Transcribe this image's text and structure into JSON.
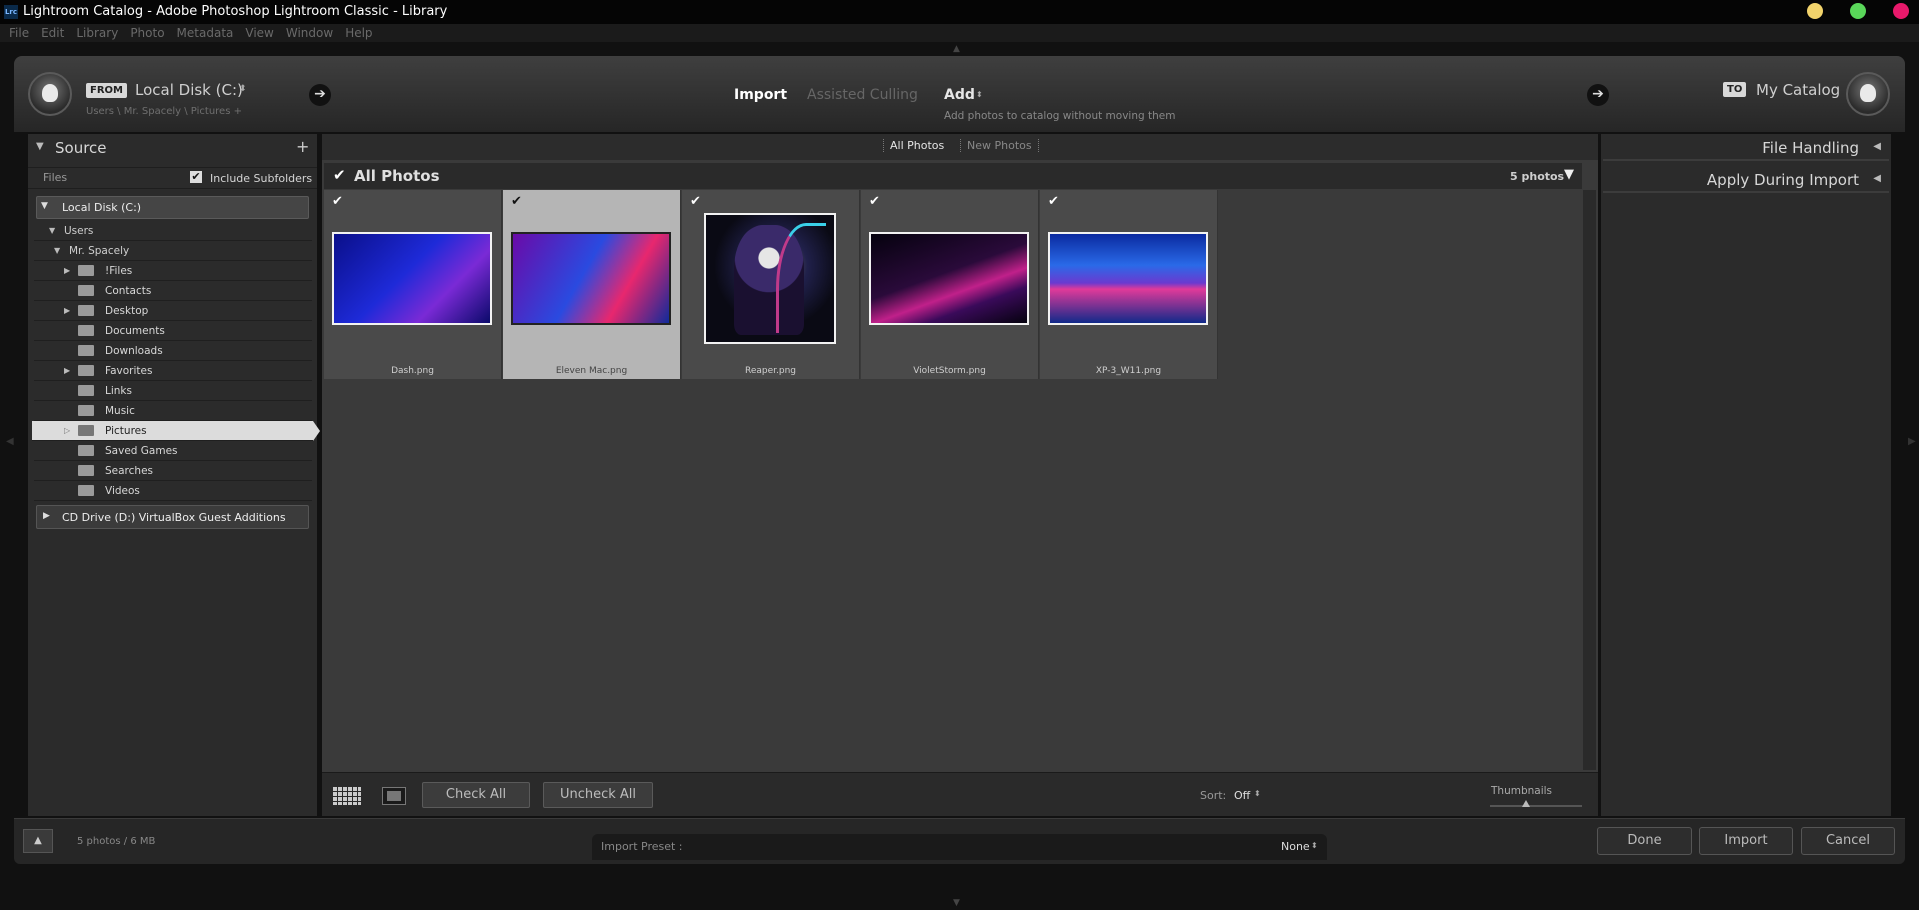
{
  "window": {
    "title": "Lightroom Catalog - Adobe Photoshop Lightroom Classic - Library",
    "app_badge": "Lrc"
  },
  "menu": [
    "File",
    "Edit",
    "Library",
    "Photo",
    "Metadata",
    "View",
    "Window",
    "Help"
  ],
  "header": {
    "from_tag": "FROM",
    "source_name": "Local Disk (C:)",
    "source_path": "Users \\ Mr. Spacely \\ Pictures +",
    "mode_import": "Import",
    "mode_culling": "Assisted Culling",
    "action": "Add",
    "action_desc": "Add photos to catalog without moving them",
    "to_tag": "TO",
    "dest_name": "My Catalog"
  },
  "source_panel": {
    "title": "Source",
    "files_label": "Files",
    "include_subfolders": "Include Subfolders",
    "drive_c": "Local Disk (C:)",
    "users": "Users",
    "user": "Mr. Spacely",
    "folders": [
      "!Files",
      "Contacts",
      "Desktop",
      "Documents",
      "Downloads",
      "Favorites",
      "Links",
      "Music",
      "Pictures",
      "Saved Games",
      "Searches",
      "Videos"
    ],
    "drive_d": "CD Drive (D:) VirtualBox Guest Additions"
  },
  "tabs": {
    "all": "All Photos",
    "new": "New Photos"
  },
  "grid": {
    "header": "All Photos",
    "count": "5 photos",
    "photos": [
      {
        "name": "Dash.png"
      },
      {
        "name": "Eleven Mac.png"
      },
      {
        "name": "Reaper.png"
      },
      {
        "name": "VioletStorm.png"
      },
      {
        "name": "XP-3_W11.png"
      }
    ]
  },
  "toolbar": {
    "check_all": "Check All",
    "uncheck_all": "Uncheck All",
    "sort_label": "Sort:",
    "sort_value": "Off",
    "thumbnails": "Thumbnails"
  },
  "right_panel": {
    "file_handling": "File Handling",
    "apply_during_import": "Apply During Import"
  },
  "footer": {
    "summary": "5 photos / 6 MB",
    "preset_label": "Import Preset :",
    "preset_value": "None",
    "done": "Done",
    "import": "Import",
    "cancel": "Cancel"
  },
  "colors": {
    "accent_yellow": "#f2d36b",
    "accent_green": "#5ad75a",
    "accent_pink": "#e8196b"
  }
}
